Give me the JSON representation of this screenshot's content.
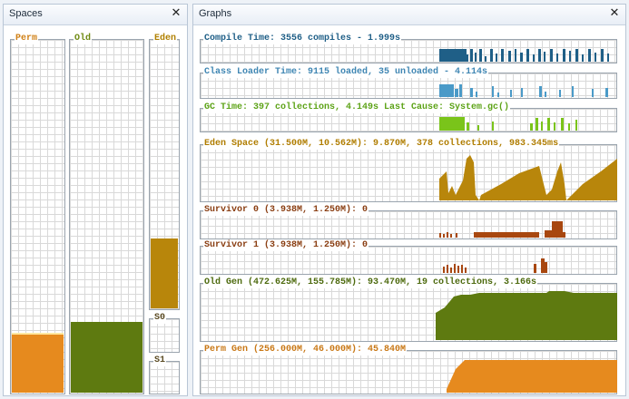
{
  "spaces_panel": {
    "title": "Spaces",
    "close_glyph": "✕",
    "bars": [
      {
        "key": "perm",
        "label": "Perm",
        "color": "#e68a1e",
        "label_color": "#d08016",
        "fill": 0.17
      },
      {
        "key": "old",
        "label": "Old",
        "color": "#5e7a10",
        "label_color": "#6f8a12",
        "fill": 0.2
      },
      {
        "key": "eden",
        "label": "Eden",
        "color": "#b8860b",
        "label_color": "#b08000",
        "fill": 0.26
      },
      {
        "key": "s0",
        "label": "S0",
        "color": "#7a5a22",
        "label_color": "#5a4a22",
        "fill": 0
      },
      {
        "key": "s1",
        "label": "S1",
        "color": "#7a5a22",
        "label_color": "#5a4a22",
        "fill": 0
      }
    ]
  },
  "graphs_panel": {
    "title": "Graphs",
    "close_glyph": "✕",
    "graphs": [
      {
        "key": "compile",
        "label": "Compile Time: 3556 compiles - 1.999s",
        "color": "#1f5f87",
        "label_color": "#1f5f87"
      },
      {
        "key": "classloader",
        "label": "Class Loader Time: 9115 loaded, 35 unloaded - 4.114s",
        "color": "#4a9ac8",
        "label_color": "#3f86b3"
      },
      {
        "key": "gc",
        "label": "GC Time: 397 collections, 4.149s  Last Cause: System.gc()",
        "color": "#7ac41a",
        "label_color": "#5da317"
      },
      {
        "key": "eden",
        "label": "Eden Space (31.500M, 10.562M): 9.870M, 378 collections, 983.345ms",
        "color": "#b8860b",
        "label_color": "#b07d00"
      },
      {
        "key": "survivor0",
        "label": "Survivor 0 (3.938M, 1.250M): 0",
        "color": "#a8470f",
        "label_color": "#8a3e12"
      },
      {
        "key": "survivor1",
        "label": "Survivor 1 (3.938M, 1.250M): 0",
        "color": "#a8470f",
        "label_color": "#8a3e12"
      },
      {
        "key": "oldgen",
        "label": "Old Gen (472.625M, 155.785M): 93.470M, 19 collections, 3.166s",
        "color": "#5e7a10",
        "label_color": "#4d6a0e"
      },
      {
        "key": "permgen",
        "label": "Perm Gen (256.000M, 46.000M): 45.840M",
        "color": "#e68a1e",
        "label_color": "#c97816"
      }
    ]
  }
}
